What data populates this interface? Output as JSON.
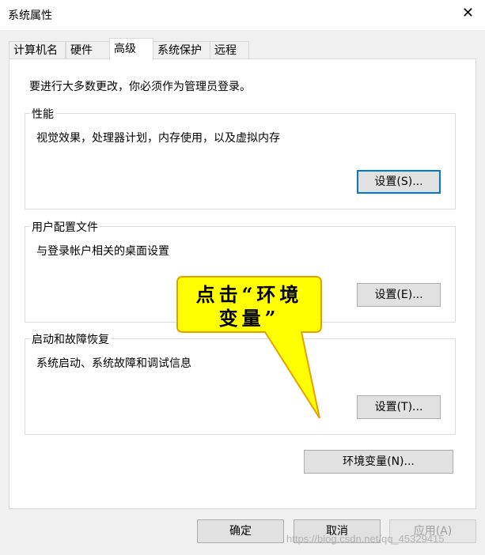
{
  "window": {
    "title": "系统属性"
  },
  "tabs": [
    {
      "label": "计算机名",
      "active": false
    },
    {
      "label": "硬件",
      "active": false
    },
    {
      "label": "高级",
      "active": true
    },
    {
      "label": "系统保护",
      "active": false
    },
    {
      "label": "远程",
      "active": false
    }
  ],
  "notice": "要进行大多数更改，你必须作为管理员登录。",
  "groups": {
    "performance": {
      "title": "性能",
      "desc": "视觉效果，处理器计划，内存使用，以及虚拟内存",
      "button": "设置(S)..."
    },
    "profiles": {
      "title": "用户配置文件",
      "desc": "与登录帐户相关的桌面设置",
      "button": "设置(E)..."
    },
    "startup": {
      "title": "启动和故障恢复",
      "desc": "系统启动、系统故障和调试信息",
      "button": "设置(T)..."
    }
  },
  "env_button": "环境变量(N)...",
  "footer": {
    "ok": "确定",
    "cancel": "取消",
    "apply": "应用(A)"
  },
  "callout": {
    "line1": "点击“环境",
    "line2": "变量”"
  },
  "watermark": "https://blog.csdn.net/qq_45329415",
  "colors": {
    "callout_fill": "#ffff00",
    "callout_border": "#e8a000",
    "focus_border": "#0078d7"
  }
}
